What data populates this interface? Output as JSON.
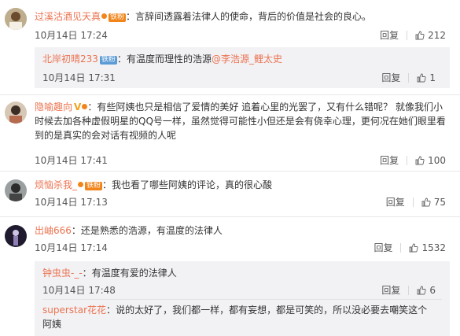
{
  "ui": {
    "reply_label": "回复",
    "colon": "："
  },
  "comments": [
    {
      "user": "过溪沽酒见天真",
      "badge": "铁粉",
      "text": "言辞间透露着法律人的使命，背后的价值是社会的良心。",
      "time": "10月14日 17:24",
      "likes": "212",
      "reply": {
        "user": "北岸初晴233",
        "badge": "铁粉",
        "text_before": "有温度而理性的浩源",
        "mention": "@李浩源_鲤太史",
        "time": "10月14日 17:31",
        "likes": "1"
      }
    },
    {
      "user": "隐喻趣向",
      "text": "有些阿姨也只是相信了爱情的美好 追着心里的光罢了，又有什么错呢？ 就像我们小时候去加各种虚假明星的QQ号一样，虽然觉得可能性小但还是会有侥幸心理，更何况在她们眼里看到的是真实的会对话有视频的人呢",
      "time": "10月14日 17:41",
      "likes": "100"
    },
    {
      "user": "烦恼杀我_",
      "badge": "铁粉",
      "text": "我也看了哪些阿姨的评论，真的很心酸",
      "time": "10月14日 17:13",
      "likes": "75"
    },
    {
      "user": "出岫666",
      "text": "还是熟悉的浩源，有温度的法律人",
      "time": "10月14日 17:14",
      "likes": "1532",
      "replies": [
        {
          "user": "钟虫虫-_-",
          "text": "有温度有爱的法律人",
          "time": "10月14日 17:48",
          "likes": "6"
        },
        {
          "user": "superstar花花",
          "text": "说的太好了，我们都一样，都有妄想，都是可笑的，所以没必要去嘲笑这个阿姨"
        }
      ]
    }
  ]
}
